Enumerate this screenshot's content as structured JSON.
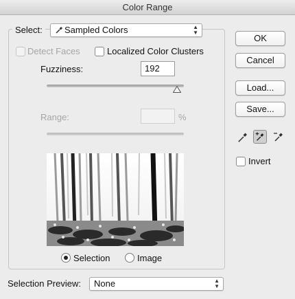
{
  "window": {
    "title": "Color Range"
  },
  "select": {
    "label": "Select:",
    "value": "Sampled Colors"
  },
  "options": {
    "detect_faces": {
      "label": "Detect Faces",
      "checked": false,
      "enabled": false
    },
    "localized_clusters": {
      "label": "Localized Color Clusters",
      "checked": false
    }
  },
  "fuzziness": {
    "label": "Fuzziness:",
    "value": "192",
    "slider_fraction": 0.95
  },
  "range": {
    "label": "Range:",
    "value": "",
    "unit": "%",
    "enabled": false
  },
  "preview_mode": {
    "selected": "Selection",
    "options": [
      "Selection",
      "Image"
    ]
  },
  "selection_preview": {
    "label": "Selection Preview:",
    "value": "None"
  },
  "buttons": {
    "ok": "OK",
    "cancel": "Cancel",
    "load": "Load...",
    "save": "Save..."
  },
  "invert": {
    "label": "Invert",
    "checked": false
  },
  "tools": [
    "eyedropper-icon",
    "eyedropper-plus-icon",
    "eyedropper-minus-icon"
  ],
  "selected_tool": "eyedropper-plus-icon"
}
